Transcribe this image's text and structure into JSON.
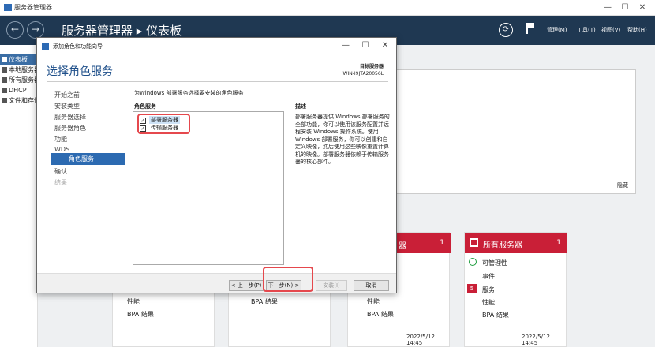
{
  "window": {
    "title": "服务器管理器",
    "controls": [
      "—",
      "☐",
      "✕"
    ]
  },
  "header": {
    "title": "服务器管理器 ▸ 仪表板",
    "refresh_glyph": "⟳",
    "back_glyph": "←",
    "fwd_glyph": "→",
    "menus": [
      "管理(M)",
      "工具(T)",
      "视图(V)",
      "帮助(H)"
    ]
  },
  "sidebar": {
    "items": [
      "仪表板",
      "本地服务器",
      "所有服务器",
      "DHCP",
      "文件和存储服务"
    ]
  },
  "background": {
    "hide_label": "隐藏",
    "tiles": [
      {
        "title": "",
        "count": "",
        "rows": [
          "性能",
          "BPA 结果"
        ]
      },
      {
        "title": "",
        "count": "",
        "rows": [
          "BPA 结果"
        ]
      },
      {
        "title": "器",
        "count": "1",
        "rows": [
          "性能",
          "BPA 结果"
        ],
        "timestamp": "2022/5/12 14:45"
      },
      {
        "title": "所有服务器",
        "count": "1",
        "rows": [
          "可管理性",
          "事件",
          "服务",
          "性能",
          "BPA 结果"
        ],
        "service_badge": "5",
        "timestamp": "2022/5/12 14:45"
      }
    ]
  },
  "wizard": {
    "window_title": "添加角色和功能向导",
    "controls": [
      "—",
      "☐",
      "✕"
    ],
    "page_title": "选择角色服务",
    "destination_label": "目标服务器",
    "destination_server": "WIN-I9JTA20056L",
    "steps": [
      "开始之前",
      "安装类型",
      "服务器选择",
      "服务器角色",
      "功能",
      "WDS",
      "角色服务",
      "确认",
      "结果"
    ],
    "active_step": "角色服务",
    "instruction": "为Windows 部署服务选择要安装的角色服务",
    "list_header": "角色服务",
    "role_services": [
      {
        "label": "部署服务器",
        "checked": true
      },
      {
        "label": "传输服务器",
        "checked": true
      }
    ],
    "check_glyph": "✓",
    "description_header": "描述",
    "description": "部署服务器提供 Windows 部署服务的全部功能，你可以使用该服务配置并远程安装 Windows 操作系统。使用 Windows 部署服务，你可以创建和自定义映像，然后使用这些映像重置计算机的映像。部署服务器依赖于传输服务器的核心部件。",
    "buttons": {
      "prev": "< 上一步(P)",
      "next": "下一步(N) >",
      "install": "安装(I)",
      "cancel": "取消"
    }
  },
  "colors": {
    "header_bg": "#1f3852",
    "accent": "#2c6ab1",
    "tile_red": "#c91f37",
    "highlight": "#e5484d"
  }
}
